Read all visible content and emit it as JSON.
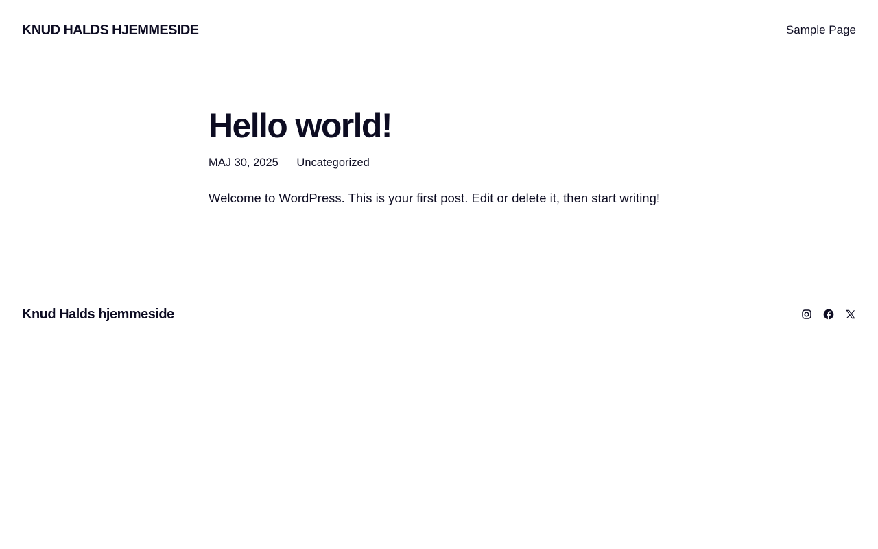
{
  "header": {
    "site_title": "KNUD HALDS HJEMMESIDE",
    "nav": [
      {
        "label": "Sample Page"
      }
    ]
  },
  "post": {
    "title": "Hello world!",
    "date": "MAJ 30, 2025",
    "category": "Uncategorized",
    "content": "Welcome to WordPress. This is your first post. Edit or delete it, then start writing!"
  },
  "footer": {
    "site_title": "Knud Halds hjemmeside",
    "social_icons": [
      "instagram-icon",
      "facebook-icon",
      "x-icon"
    ]
  },
  "colors": {
    "text": "#0d0c22",
    "background": "#ffffff"
  }
}
